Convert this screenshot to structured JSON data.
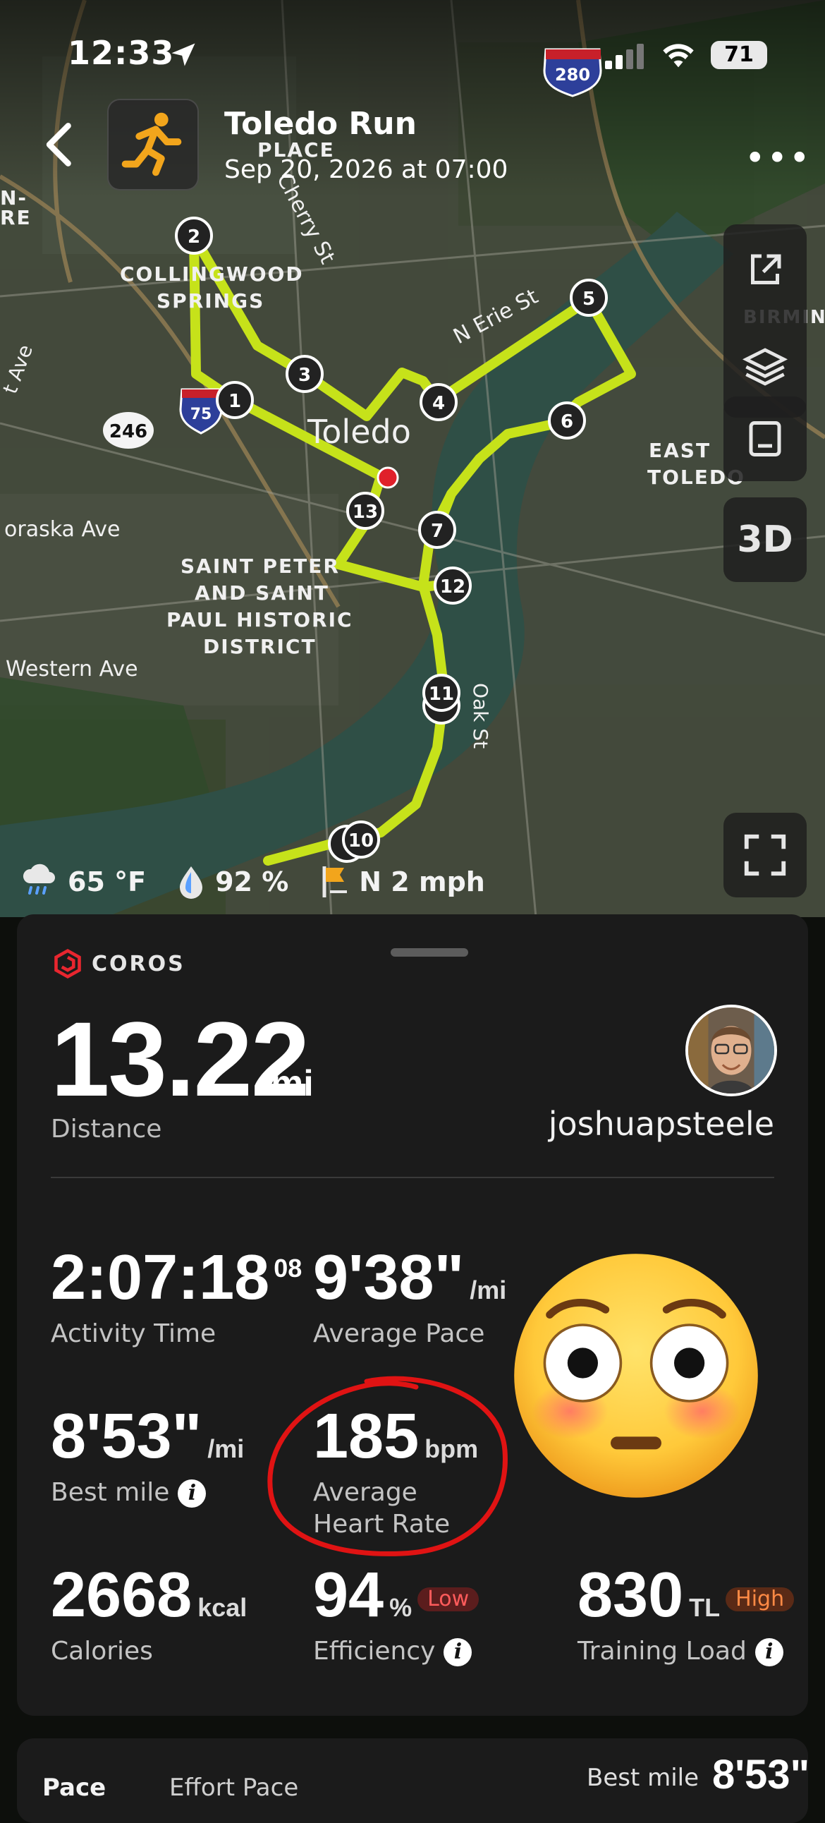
{
  "status_bar": {
    "time": "12:33",
    "battery": "71"
  },
  "header": {
    "title": "Toledo Run",
    "subtitle": "Sep 20, 2026 at 07:00"
  },
  "map": {
    "labels": {
      "place": "PLACE",
      "cherry": "Cherry St",
      "collingwood1": "COLLINGWOOD",
      "collingwood2": "SPRINGS",
      "erie": "N Erie St",
      "toledo": "Toledo",
      "east1": "EAST",
      "east2": "TOLEDO",
      "nebraska": "oraska Ave",
      "saint1": "SAINT PETER",
      "saint2": "AND SAINT",
      "saint3": "PAUL HISTORIC",
      "saint4": "DISTRICT",
      "western": "Western Ave",
      "oak": "Oak St",
      "route246": "246",
      "i75": "75",
      "i280": "280",
      "n_re": "N-",
      "re": "RE",
      "birmin": "BIRMIN",
      "ave": "t Ave"
    },
    "markers": [
      "1",
      "2",
      "3",
      "4",
      "5",
      "6",
      "7",
      "10",
      "11",
      "12",
      "13"
    ],
    "route_color": "#c6e21a"
  },
  "side_controls": {
    "btn_3d": "3D"
  },
  "weather": {
    "temperature": "65 °F",
    "humidity": "92 %",
    "wind": "N 2 mph"
  },
  "card": {
    "brand": "COROS",
    "distance": {
      "value": "13.22",
      "unit": "mi",
      "label": "Distance"
    },
    "username": "joshuapsteele",
    "stats": {
      "activity_time": {
        "value": "2:07:18",
        "sup": "08",
        "label": "Activity Time"
      },
      "avg_pace": {
        "value": "9'38\"",
        "unit": "/mi",
        "label": "Average Pace"
      },
      "best_mile": {
        "value": "8'53\"",
        "unit": "/mi",
        "label": "Best mile"
      },
      "avg_hr": {
        "value": "185",
        "unit": "bpm",
        "label1": "Average",
        "label2": "Heart Rate"
      },
      "calories": {
        "value": "2668",
        "unit": "kcal",
        "label": "Calories"
      },
      "efficiency": {
        "value": "94",
        "unit": "%",
        "badge": "Low",
        "label": "Efficiency"
      },
      "training_load": {
        "value": "830",
        "unit": "TL",
        "badge": "High",
        "label": "Training Load"
      }
    }
  },
  "bottom_card": {
    "tab1": "Pace",
    "tab2": "Effort Pace",
    "best_mile_label": "Best mile",
    "best_mile_value": "8'53\""
  },
  "colors": {
    "accent_route": "#c6e21a",
    "low_badge": "#ff5b5b",
    "high_badge": "#ff8a45",
    "annotation_red": "#e01313"
  }
}
